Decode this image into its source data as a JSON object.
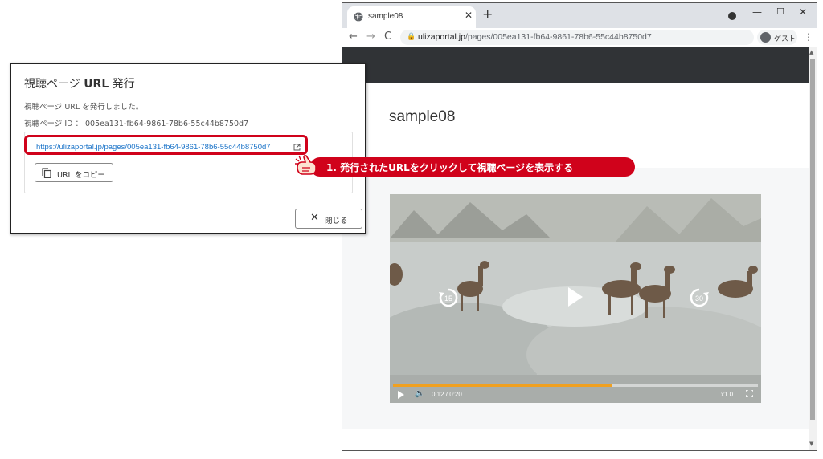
{
  "browser": {
    "tab_title": "sample08",
    "tab_close": "✕",
    "new_tab": "+",
    "window_min": "—",
    "window_max": "☐",
    "window_close": "✕",
    "nav_back": "←",
    "nav_forward": "→",
    "nav_reload": "C",
    "url_host": "ulizaportal.jp",
    "url_path": "/pages/005ea131-fb64-9861-78b6-55c44b8750d7",
    "guest_label": "ゲスト",
    "menu": "⋮"
  },
  "page": {
    "title": "sample08"
  },
  "player": {
    "time": "0:12 / 0:20",
    "speed": "x1.0",
    "progress": 0.6,
    "rewind_label": "15",
    "forward_label": "30",
    "accent_color": "#f0a020"
  },
  "dialog": {
    "title_prefix": "視聴ページ",
    "title_bold": "URL",
    "title_suffix": "発行",
    "message": "視聴ページ URL を発行しました。",
    "id_line": "視聴ページ ID ： 005ea131-fb64-9861-78b6-55c44b8750d7",
    "link": "https://ulizaportal.jp/pages/005ea131-fb64-9861-78b6-55c44b8750d7",
    "copy_button": "URL をコピー",
    "close_button": "閉じる",
    "close_icon": "✕"
  },
  "annotation": {
    "callout": "1. 発行されたURLをクリックして視聴ページを表示する",
    "highlight_color": "#d0021b"
  },
  "icons": {
    "tab_favicon": "globe-icon",
    "lock": "lock-icon",
    "external_link": "external-link-icon",
    "copy": "copy-icon",
    "hand": "pointing-hand-icon"
  }
}
